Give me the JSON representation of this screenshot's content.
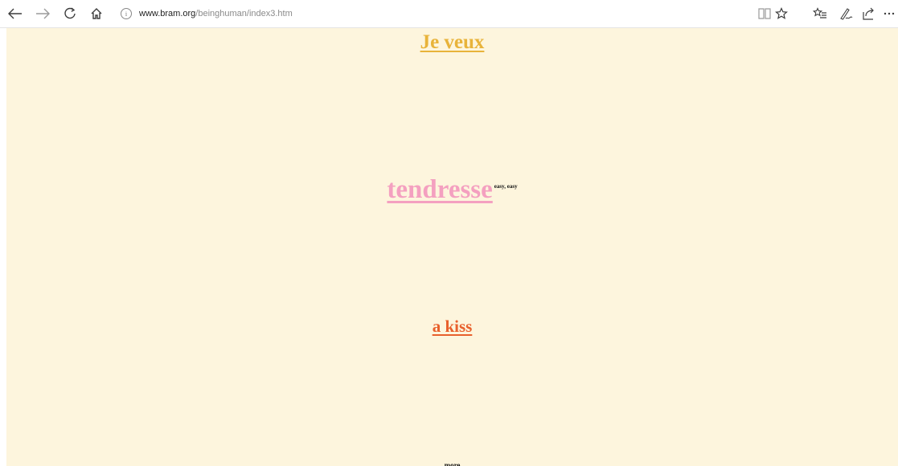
{
  "browser": {
    "url_domain": "www.bram.org",
    "url_path": "/beinghuman/index3.htm",
    "info_glyph": "i",
    "icons": {
      "back": "back-arrow-icon",
      "forward": "forward-arrow-icon",
      "refresh": "refresh-icon",
      "home": "home-icon",
      "reading_view": "reading-view-icon",
      "favorite": "star-icon",
      "favorites_hub": "favorites-list-icon",
      "notes": "pen-icon",
      "share": "share-icon",
      "more": "more-icon"
    }
  },
  "page": {
    "background": "#fdf5dd",
    "line1": {
      "text": "Je veux",
      "color": "#e8b33a"
    },
    "line2": {
      "text": "tendresse",
      "color": "#f4a0c0",
      "aside": "easy, easy"
    },
    "line3": {
      "text": "a kiss",
      "color": "#e8602c"
    },
    "line4": {
      "text": "more"
    }
  }
}
